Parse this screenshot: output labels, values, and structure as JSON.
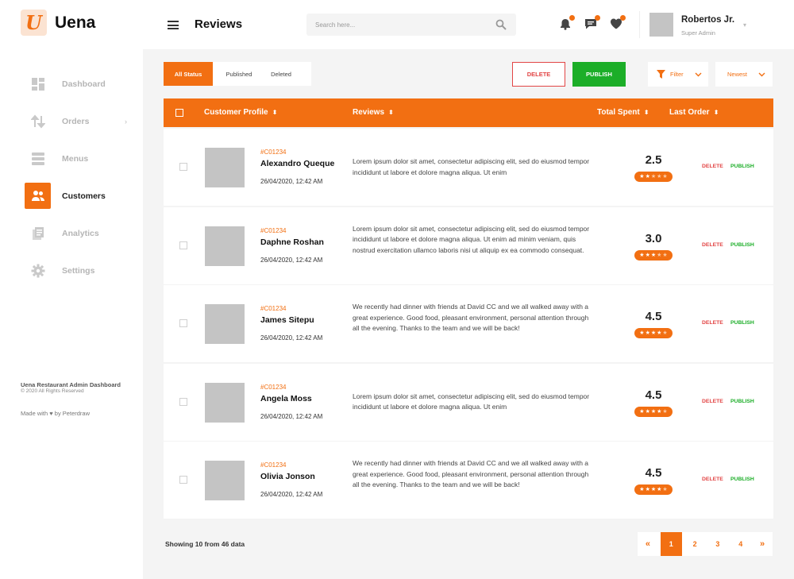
{
  "brand": {
    "logo_letter": "U",
    "name": "Uena"
  },
  "sidebar": {
    "items": [
      {
        "label": "Dashboard",
        "icon": "dashboard-icon"
      },
      {
        "label": "Orders",
        "icon": "orders-icon",
        "caret": "›"
      },
      {
        "label": "Menus",
        "icon": "menus-icon"
      },
      {
        "label": "Customers",
        "icon": "customers-icon",
        "active": true
      },
      {
        "label": "Analytics",
        "icon": "analytics-icon"
      },
      {
        "label": "Settings",
        "icon": "settings-icon"
      }
    ],
    "footer_title": "Uena Restaurant Admin Dashboard",
    "footer_copy": "© 2020 All Rights Reserved",
    "footer_made": "Made with ♥ by Peterdraw"
  },
  "header": {
    "title": "Reviews",
    "search_placeholder": "Search here...",
    "user_name": "Robertos Jr.",
    "user_role": "Super Admin",
    "icons": [
      "bell-icon",
      "chat-icon",
      "heart-icon"
    ]
  },
  "toolbar": {
    "tabs": [
      "All Status",
      "Published",
      "Deleted"
    ],
    "delete_label": "DELETE",
    "publish_label": "PUBLISH",
    "filter_label": "Filter",
    "sort_label": "Newest"
  },
  "table": {
    "headers": {
      "customer": "Customer Profile",
      "reviews": "Reviews",
      "total": "Total Spent",
      "last": "Last Order",
      "sort_glyph": "⬍"
    },
    "rows": [
      {
        "id": "#C01234",
        "name": "Alexandro Queque",
        "date": "26/04/2020, 12:42 AM",
        "text": "Lorem ipsum dolor sit amet, consectetur adipiscing elit, sed do eiusmod tempor incididunt ut labore et dolore magna aliqua. Ut enim",
        "rating": "2.5",
        "stars": 2,
        "delete": "DELETE",
        "publish": "PUBLISH"
      },
      {
        "id": "#C01234",
        "name": "Daphne Roshan",
        "date": "26/04/2020, 12:42 AM",
        "text": "Lorem ipsum dolor sit amet, consectetur adipiscing elit, sed do eiusmod tempor incididunt ut labore et dolore magna aliqua. Ut enim ad minim veniam, quis nostrud exercitation ullamco laboris nisi ut aliquip ex ea commodo consequat.",
        "rating": "3.0",
        "stars": 3,
        "delete": "DELETE",
        "publish": "PUBLISH"
      },
      {
        "id": "#C01234",
        "name": "James Sitepu",
        "date": "26/04/2020, 12:42 AM",
        "text": "We recently had dinner with friends at David CC and we all walked away with a great experience. Good food, pleasant environment, personal attention through all the evening. Thanks to the team and we will be back!",
        "rating": "4.5",
        "stars": 4,
        "delete": "DELETE",
        "publish": "PUBLISH"
      },
      {
        "id": "#C01234",
        "name": "Angela Moss",
        "date": "26/04/2020, 12:42 AM",
        "text": "Lorem ipsum dolor sit amet, consectetur adipiscing elit, sed do eiusmod tempor incididunt ut labore et dolore magna aliqua. Ut enim",
        "rating": "4.5",
        "stars": 4,
        "delete": "DELETE",
        "publish": "PUBLISH"
      },
      {
        "id": "#C01234",
        "name": "Olivia Jonson",
        "date": "26/04/2020, 12:42 AM",
        "text": "We recently had dinner with friends at David CC and we all walked away with a great experience. Good food, pleasant environment, personal attention through all the evening. Thanks to the team and we will be back!",
        "rating": "4.5",
        "stars": 4,
        "delete": "DELETE",
        "publish": "PUBLISH"
      }
    ]
  },
  "pagination": {
    "showing": "Showing 10 from 46 data",
    "prev": "«",
    "pages": [
      "1",
      "2",
      "3",
      "4"
    ],
    "current": "1",
    "next": "»"
  },
  "colors": {
    "accent": "#f26f12",
    "danger": "#e24545",
    "success": "#1cae28"
  }
}
